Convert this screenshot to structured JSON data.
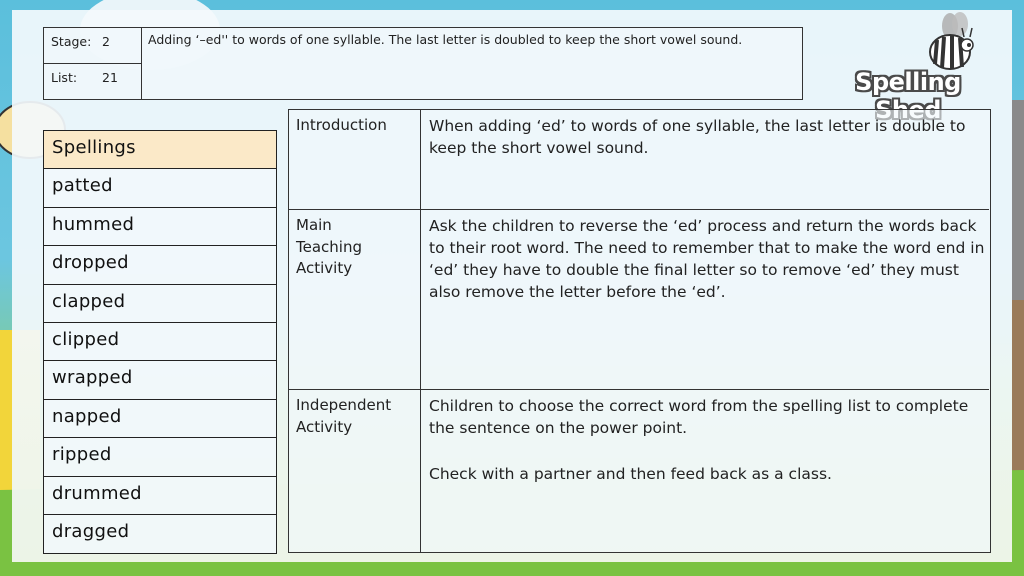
{
  "header": {
    "stage_label": "Stage:",
    "stage_value": "2",
    "list_label": "List:",
    "list_value": "21",
    "description": "Adding ‘–ed'' to words of one syllable.  The last letter is doubled to keep the short vowel sound."
  },
  "logo": {
    "text": "Spelling Shed",
    "icon": "bee-icon"
  },
  "spellings": {
    "header": "Spellings",
    "words": [
      "patted",
      "hummed",
      "dropped",
      "clapped",
      "clipped",
      "wrapped",
      "napped",
      "ripped",
      "drummed",
      "dragged"
    ]
  },
  "plan": {
    "rows": [
      {
        "label": "Introduction",
        "paragraphs": [
          "When adding ‘ed’ to words of one syllable, the last letter is double to keep the short vowel sound."
        ]
      },
      {
        "label": "Main Teaching Activity",
        "paragraphs": [
          "Ask the children to reverse the ‘ed’ process and return the words back to their root word. The need to remember that to make the word end in ‘ed’ they have to double the final letter so to remove ‘ed’ they must also remove the letter before the ‘ed’."
        ]
      },
      {
        "label": "Independent Activity",
        "paragraphs": [
          "Children to choose the correct word from the spelling list to complete the sentence on the power point.",
          "Check with a partner and then feed back as a class."
        ]
      }
    ]
  },
  "colors": {
    "sky": "#5bbfdc",
    "grass": "#6fbf3a",
    "spellings_header_bg": "#fbe9c8",
    "border": "#333333"
  }
}
